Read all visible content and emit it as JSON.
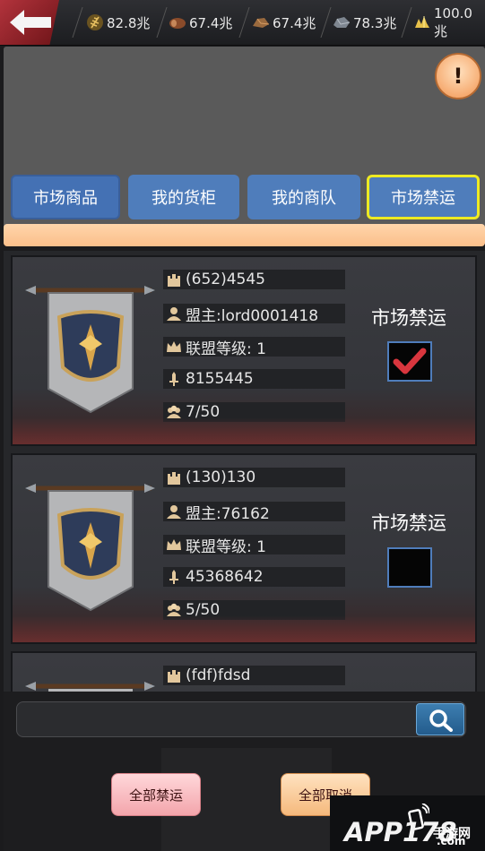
{
  "resources": [
    {
      "name": "grain-icon",
      "value": "82.8兆"
    },
    {
      "name": "wood-icon",
      "value": "67.4兆"
    },
    {
      "name": "ore-icon",
      "value": "67.4兆"
    },
    {
      "name": "stone-icon",
      "value": "78.3兆"
    },
    {
      "name": "gold-icon",
      "value": "100.0兆"
    }
  ],
  "header": {
    "info_label": "!"
  },
  "tabs": [
    {
      "label": "市场商品",
      "active": false
    },
    {
      "label": "我的货柜",
      "active": false
    },
    {
      "label": "我的商队",
      "active": false
    },
    {
      "label": "市场禁运",
      "active": true
    }
  ],
  "alliances": [
    {
      "name": "(652)4545",
      "leader": "盟主:lord0001418",
      "level": "联盟等级: 1",
      "power": "8155445",
      "members": "7/50",
      "embargo_label": "市场禁运",
      "embargoed": true
    },
    {
      "name": "(130)130",
      "leader": "盟主:76162",
      "level": "联盟等级: 1",
      "power": "45368642",
      "members": "5/50",
      "embargo_label": "市场禁运",
      "embargoed": false
    },
    {
      "name": "(fdf)fdsd",
      "leader": "",
      "level": "",
      "power": "",
      "members": "",
      "embargo_label": "",
      "embargoed": false
    }
  ],
  "search": {
    "value": "",
    "placeholder": ""
  },
  "actions": {
    "ban_all": "全部禁运",
    "cancel_all": "全部取消"
  },
  "watermark": {
    "brand": "APP178",
    "sub": "手游网",
    "domain": ".com"
  }
}
